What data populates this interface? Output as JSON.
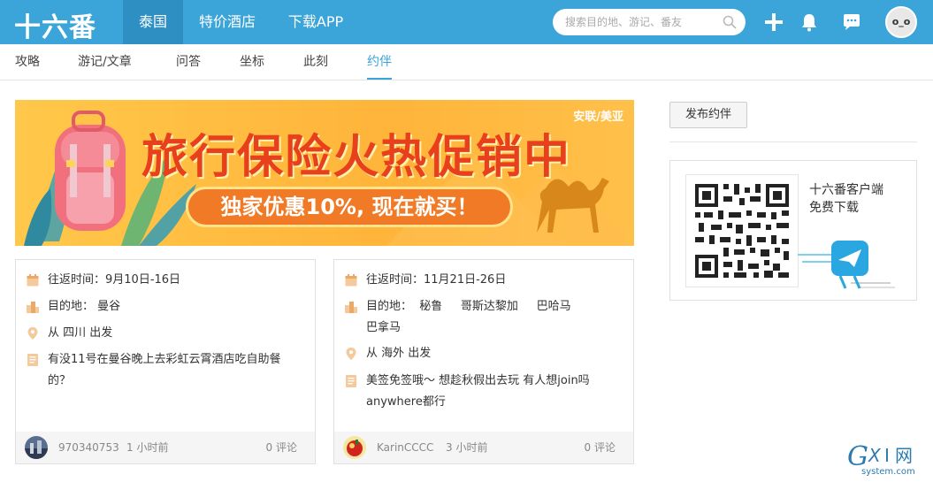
{
  "topbar": {
    "logo": "十六番",
    "nav": [
      {
        "label": "泰国",
        "active": true
      },
      {
        "label": "特价酒店",
        "active": false
      },
      {
        "label": "下载APP",
        "active": false
      }
    ],
    "search_placeholder": "搜索目的地、游记、番友",
    "avatar_text": "o_o",
    "accent_color": "#3ba4d9"
  },
  "subnav": [
    {
      "label": "攻略"
    },
    {
      "label": "游记/文章"
    },
    {
      "label": "问答"
    },
    {
      "label": "坐标"
    },
    {
      "label": "此刻"
    },
    {
      "label": "约伴",
      "active": true
    }
  ],
  "banner": {
    "title": "旅行保险火热促销中",
    "subtitle": "独家优惠10%, 现在就买！",
    "corner": "安联/美亚"
  },
  "cards": [
    {
      "date": "往返时间：9月10日-16日",
      "destination": "目的地：  曼谷",
      "origin": "从 四川 出发",
      "desc_line1": "有没11号在曼谷晚上去彩虹云霄酒店吃自助餐",
      "desc_line2": "的？",
      "user": "970340753",
      "time": "1 小时前",
      "comments": "0 评论"
    },
    {
      "date": "往返时间：11月21日-26日",
      "destination_line1": "目的地：  秘鲁     哥斯达黎加     巴哈马",
      "destination_line2": "巴拿马",
      "origin": "从 海外 出发",
      "desc_line1": "美签免签哦～ 想趁秋假出去玩 有人想join吗",
      "desc_line2": "anywhere都行",
      "user": "KarinCCCC",
      "time": "3 小时前",
      "comments": "0 评论"
    }
  ],
  "sidebar": {
    "publish_button": "发布约伴",
    "app_line1": "十六番客户端",
    "app_line2": "免费下载"
  },
  "watermark": {
    "text": "GXI网",
    "sub": "system.com"
  }
}
